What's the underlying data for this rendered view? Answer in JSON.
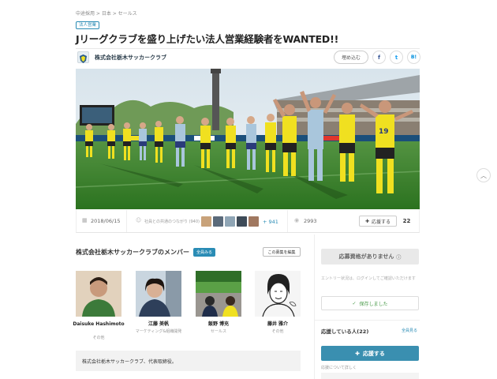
{
  "breadcrumb": "中途採用 > 日本 > セールス",
  "tag": "法人営業",
  "title": "Jリーグクラブを盛り上げたい法人営業経験者をWANTED!!",
  "company": {
    "name": "株式会社栃木サッカークラブ",
    "logo_icon": "club-crest-icon"
  },
  "actions": {
    "embed": "埋め込む",
    "share_facebook": "f",
    "share_twitter": "t",
    "share_hatena": "B!"
  },
  "stats": {
    "date": "2018/06/15",
    "connections_label": "社員との共通のつながり (940)",
    "connections_more": "+ 941",
    "views": "2993",
    "support_label": "応援する",
    "support_count": "22"
  },
  "members": {
    "title": "株式会社栃木サッカークラブのメンバー",
    "see_all": "全員みる",
    "edit": "この募集を編集",
    "list": [
      {
        "name": "Daisuke Hashimoto",
        "role": "その他"
      },
      {
        "name": "江藤 美帆",
        "role": "マーケティング&組織開発"
      },
      {
        "name": "飯野 博充",
        "role": "セールス"
      },
      {
        "name": "藤井 雅介",
        "role": "その他"
      }
    ]
  },
  "description": "株式会社栃木サッカークラブ、代表取締役。",
  "sidebar": {
    "ineligible": "応募資格がありません",
    "notice": "エントリー状況は、ログインしてご確認いただけます",
    "saved": "保存しました",
    "supporting_title": "応援している人(22)",
    "see_all": "全員見る",
    "support_button": "応援する",
    "about_support": "応援について詳しく"
  },
  "colors": {
    "accent": "#2a8cb5",
    "team_yellow": "#f0e020",
    "pitch_green": "#3e8a2e"
  }
}
